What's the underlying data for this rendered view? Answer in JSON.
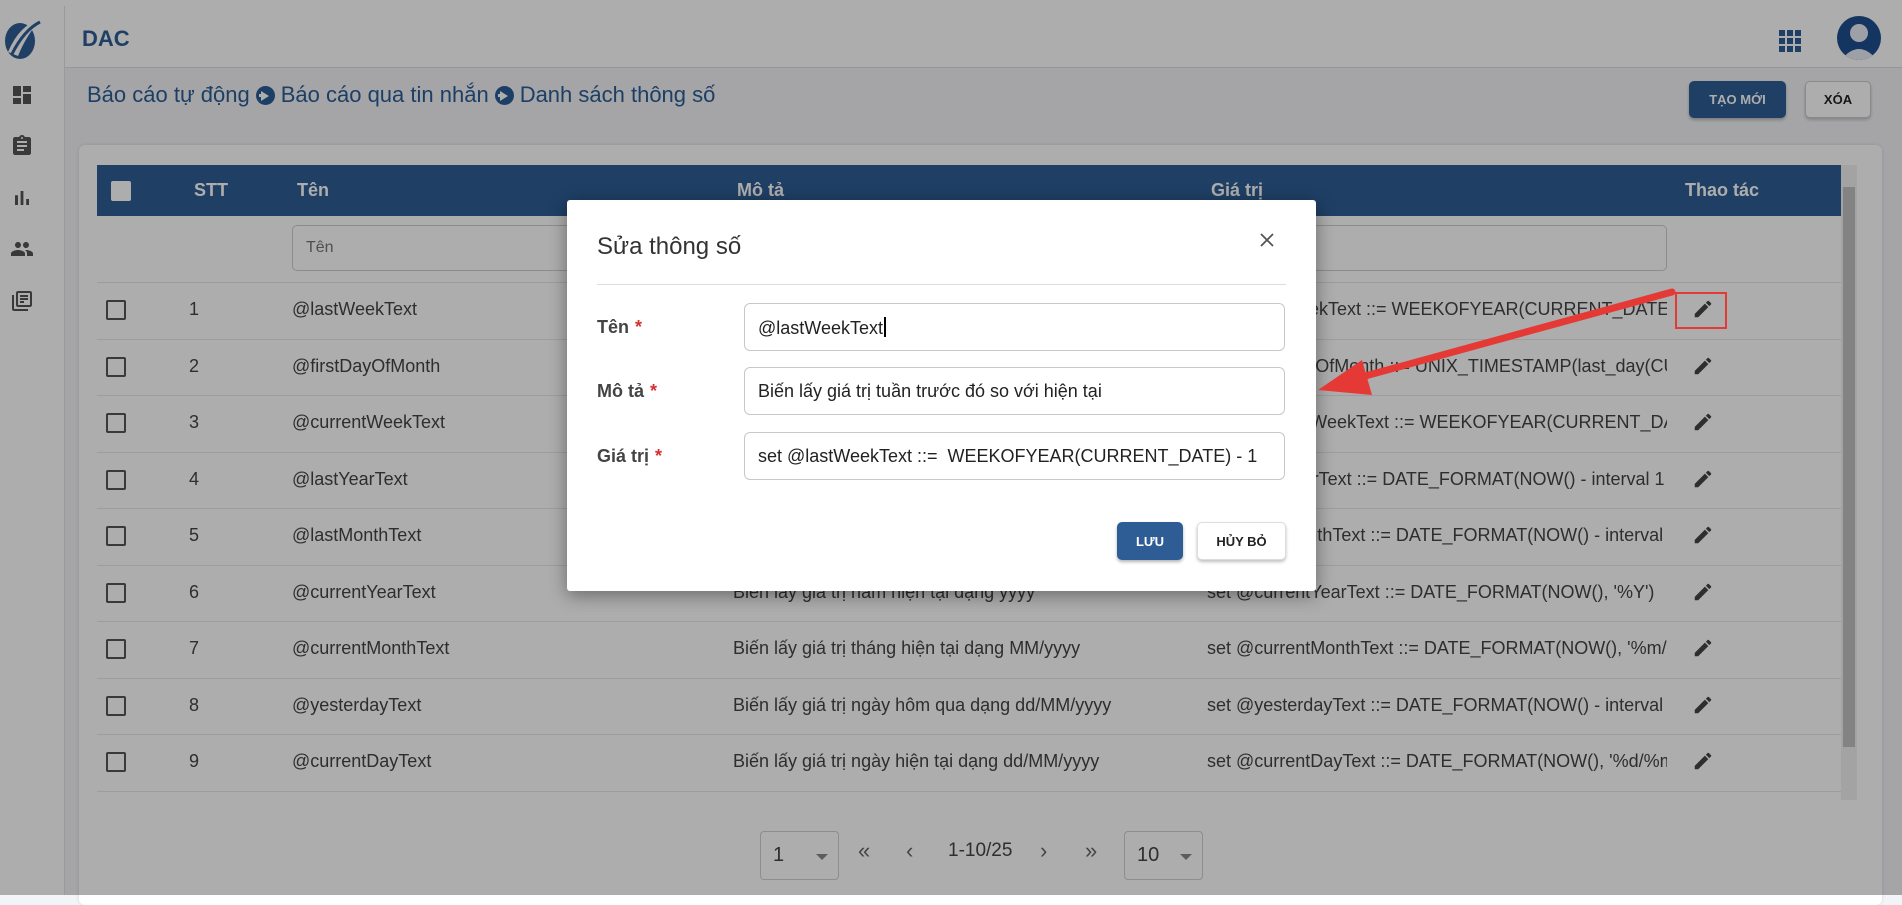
{
  "app": {
    "title": "DAC"
  },
  "breadcrumb": [
    "Báo cáo tự động",
    "Báo cáo qua tin nhắn",
    "Danh sách thông số"
  ],
  "actions": {
    "new_label": "TẠO MỚI",
    "delete_label": "XÓA"
  },
  "table": {
    "columns": {
      "stt": "STT",
      "name": "Tên",
      "desc": "Mô tả",
      "value": "Giá trị",
      "actions": "Thao tác"
    },
    "filter": {
      "name_placeholder": "Tên"
    },
    "rows": [
      {
        "stt": "1",
        "name": "@lastWeekText",
        "desc": "",
        "value": "set @lastWeekText ::= WEEKOFYEAR(CURRENT_DATE) - 1"
      },
      {
        "stt": "2",
        "name": "@firstDayOfMonth",
        "desc": "",
        "value": "set @firstDayOfMonth ::= UNIX_TIMESTAMP(last_day(CU..."
      },
      {
        "stt": "3",
        "name": "@currentWeekText",
        "desc": "",
        "value": "set @currentWeekText ::= WEEKOFYEAR(CURRENT_DATE)"
      },
      {
        "stt": "4",
        "name": "@lastYearText",
        "desc": "",
        "value": "set @lastYearText ::= DATE_FORMAT(NOW() - interval 1 y..."
      },
      {
        "stt": "5",
        "name": "@lastMonthText",
        "desc": "",
        "value": "set @lastMonthText ::= DATE_FORMAT(NOW() - interval 1..."
      },
      {
        "stt": "6",
        "name": "@currentYearText",
        "desc": "Biến lấy giá trị năm hiện tại dạng yyyy",
        "value": "set @currentYearText ::= DATE_FORMAT(NOW(), '%Y')"
      },
      {
        "stt": "7",
        "name": "@currentMonthText",
        "desc": "Biến lấy giá trị tháng hiện tại dạng MM/yyyy",
        "value": "set @currentMonthText ::= DATE_FORMAT(NOW(), '%m/%..."
      },
      {
        "stt": "8",
        "name": "@yesterdayText",
        "desc": "Biến lấy giá trị ngày hôm qua dạng dd/MM/yyyy",
        "value": "set @yesterdayText ::= DATE_FORMAT(NOW() - interval 1 ..."
      },
      {
        "stt": "9",
        "name": "@currentDayText",
        "desc": "Biến lấy giá trị ngày hiện tại dạng dd/MM/yyyy",
        "value": "set @currentDayText ::= DATE_FORMAT(NOW(), '%d/%m/..."
      }
    ]
  },
  "pagination": {
    "page": "1",
    "range": "1-10/25",
    "page_size": "10"
  },
  "modal": {
    "title": "Sửa thông số",
    "fields": {
      "name": {
        "label": "Tên",
        "value": "@lastWeekText"
      },
      "desc": {
        "label": "Mô tả",
        "value": "Biến lấy giá trị tuần trước đó so với hiện tại"
      },
      "value": {
        "label": "Giá trị",
        "value": "set @lastWeekText ::=  WEEKOFYEAR(CURRENT_DATE) - 1"
      }
    },
    "required_mark": "*",
    "save_label": "LƯU",
    "cancel_label": "HỦY BỎ"
  },
  "colors": {
    "primary": "#2e5d95",
    "annotation": "#e53935"
  }
}
